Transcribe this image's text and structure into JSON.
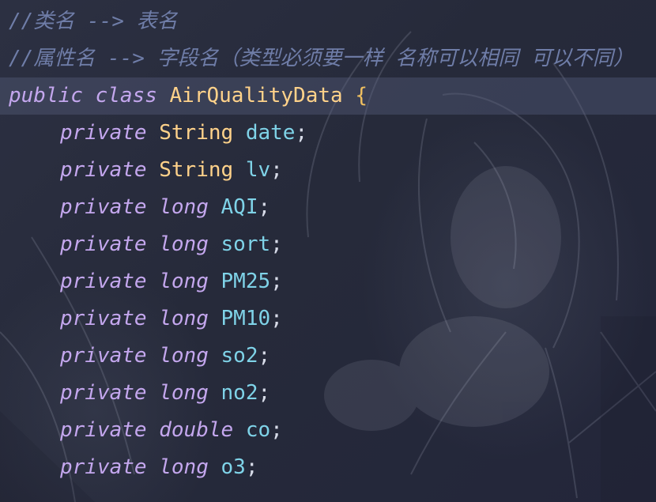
{
  "comments": [
    "//类名 --> 表名",
    "//属性名 --> 字段名（类型必须要一样 名称可以相同 可以不同）"
  ],
  "class_decl": {
    "modifier": "public",
    "keyword": "class",
    "name": "AirQualityData",
    "open_brace": "{"
  },
  "fields": [
    {
      "modifier": "private",
      "type": "String",
      "name": "date",
      "end": ";"
    },
    {
      "modifier": "private",
      "type": "String",
      "name": "lv",
      "end": ";"
    },
    {
      "modifier": "private",
      "type": "long",
      "name": "AQI",
      "end": ";"
    },
    {
      "modifier": "private",
      "type": "long",
      "name": "sort",
      "end": ";"
    },
    {
      "modifier": "private",
      "type": "long",
      "name": "PM25",
      "end": ";"
    },
    {
      "modifier": "private",
      "type": "long",
      "name": "PM10",
      "end": ";"
    },
    {
      "modifier": "private",
      "type": "long",
      "name": "so2",
      "end": ";"
    },
    {
      "modifier": "private",
      "type": "long",
      "name": "no2",
      "end": ";"
    },
    {
      "modifier": "private",
      "type": "double",
      "name": "co",
      "end": ";"
    },
    {
      "modifier": "private",
      "type": "long",
      "name": "o3",
      "end": ";"
    }
  ],
  "colors": {
    "background": "#272a39",
    "comment": "#6f7da8",
    "keyword": "#c4a7ee",
    "class_type": "#ffd28a",
    "field_name": "#7fd3e8",
    "current_line": "#3d4160"
  }
}
